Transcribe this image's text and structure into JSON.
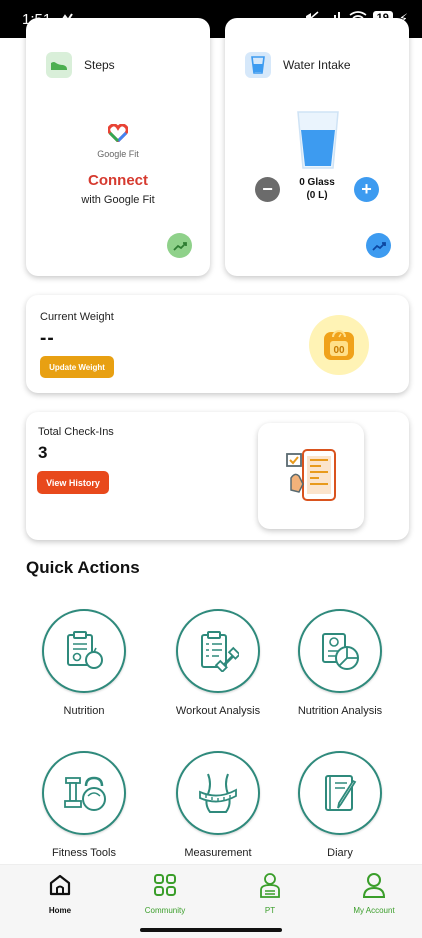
{
  "status_bar": {
    "time": "1:51",
    "battery": "19"
  },
  "colors": {
    "accent_green": "#3a9e2a",
    "connect_red": "#d63a2f",
    "update_orange": "#e8a012",
    "history_orange": "#e8491c",
    "action_ring": "#2f8a7c",
    "water_blue": "#3d9bf0"
  },
  "steps_card": {
    "title": "Steps",
    "icon": "shoe-icon",
    "logo_label": "Google Fit",
    "connect_label": "Connect",
    "subtitle": "with Google Fit",
    "trend_icon": "trend-up-icon"
  },
  "water_card": {
    "title": "Water Intake",
    "icon": "glass-icon",
    "glass_count": "0 Glass",
    "liters": "(0 L)",
    "minus_icon": "minus-icon",
    "plus_icon": "plus-icon",
    "trend_icon": "trend-up-icon"
  },
  "weight_card": {
    "title": "Current Weight",
    "value": "--",
    "button_label": "Update Weight",
    "icon": "scale-icon"
  },
  "checkin_card": {
    "title": "Total Check-Ins",
    "value": "3",
    "button_label": "View History",
    "icon": "tablet-checklist-icon"
  },
  "quick_actions": {
    "title": "Quick Actions",
    "items": [
      {
        "label": "Nutrition",
        "icon": "nutrition-clipboard-icon"
      },
      {
        "label": "Workout Analysis",
        "icon": "workout-clipboard-icon"
      },
      {
        "label": "Nutrition Analysis",
        "icon": "nutrition-chart-icon"
      },
      {
        "label": "Fitness Tools",
        "icon": "dumbbell-kettlebell-icon"
      },
      {
        "label": "Measurement",
        "icon": "waist-tape-icon"
      },
      {
        "label": "Diary",
        "icon": "diary-pen-icon"
      }
    ]
  },
  "bottom_nav": {
    "items": [
      {
        "label": "Home",
        "icon": "home-icon",
        "active": true
      },
      {
        "label": "Community",
        "icon": "grid-icon",
        "active": false
      },
      {
        "label": "PT",
        "icon": "trainer-icon",
        "active": false
      },
      {
        "label": "My Account",
        "icon": "user-icon",
        "active": false
      }
    ]
  }
}
